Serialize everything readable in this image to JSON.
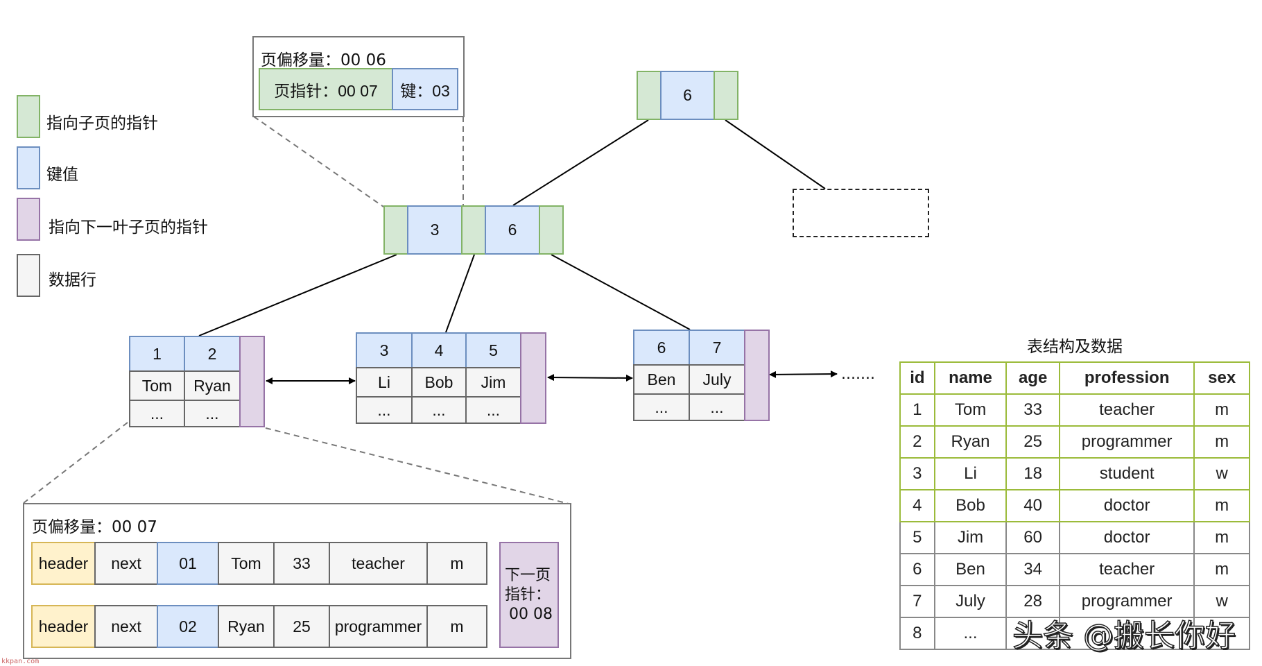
{
  "legend": [
    {
      "label": "指向子页的指针",
      "kind": "child-pointer"
    },
    {
      "label": "键值",
      "kind": "key"
    },
    {
      "label": "指向下一叶子页的指针",
      "kind": "next-leaf-pointer"
    },
    {
      "label": "数据行",
      "kind": "data-row"
    }
  ],
  "colors": {
    "pointer_fill": "#d5e8d4",
    "key_fill": "#dae8fc",
    "next_leaf_fill": "#e1d5e7",
    "data_row_fill": "#f5f5f5",
    "header_fill": "#fff2cc",
    "table_highlight_border": "#9bbb3a"
  },
  "callout_top": {
    "title": "页偏移量：00 06",
    "pointer": "页指针：00 07",
    "key": "键：03"
  },
  "root": {
    "key": "6"
  },
  "internal": {
    "keys": [
      "3",
      "6"
    ]
  },
  "leaves": [
    {
      "keys": [
        "1",
        "2"
      ],
      "names": [
        "Tom",
        "Ryan"
      ],
      "more": [
        "...",
        "..."
      ]
    },
    {
      "keys": [
        "3",
        "4",
        "5"
      ],
      "names": [
        "Li",
        "Bob",
        "Jim"
      ],
      "more": [
        "...",
        "...",
        "..."
      ]
    },
    {
      "keys": [
        "6",
        "7"
      ],
      "names": [
        "Ben",
        "July"
      ],
      "more": [
        "...",
        "..."
      ]
    }
  ],
  "ellipsis": ".......",
  "detail": {
    "title": "页偏移量：00 07",
    "rows": [
      {
        "header": "header",
        "next": "next",
        "id": "01",
        "name": "Tom",
        "age": "33",
        "profession": "teacher",
        "sex": "m"
      },
      {
        "header": "header",
        "next": "next",
        "id": "02",
        "name": "Ryan",
        "age": "25",
        "profession": "programmer",
        "sex": "m"
      }
    ],
    "next_page_line1": "下一页",
    "next_page_line2": "指针：",
    "next_page_line3": "00 08"
  },
  "table": {
    "title": "表结构及数据",
    "columns": [
      "id",
      "name",
      "age",
      "profession",
      "sex"
    ],
    "rows": [
      [
        "1",
        "Tom",
        "33",
        "teacher",
        "m"
      ],
      [
        "2",
        "Ryan",
        "25",
        "programmer",
        "m"
      ],
      [
        "3",
        "Li",
        "18",
        "student",
        "w"
      ],
      [
        "4",
        "Bob",
        "40",
        "doctor",
        "m"
      ],
      [
        "5",
        "Jim",
        "60",
        "doctor",
        "m"
      ],
      [
        "6",
        "Ben",
        "34",
        "teacher",
        "m"
      ],
      [
        "7",
        "July",
        "28",
        "programmer",
        "w"
      ],
      [
        "8",
        "...",
        "",
        "",
        ""
      ]
    ]
  },
  "watermark": "头条 @搬长你好",
  "site_mark": "kkpan.com"
}
